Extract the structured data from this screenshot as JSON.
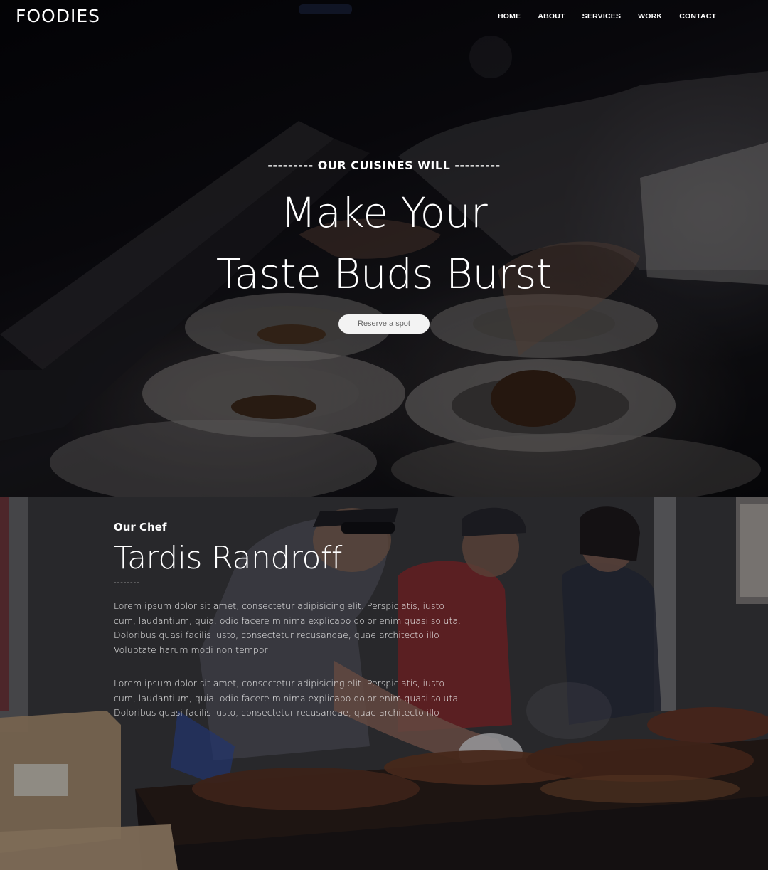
{
  "brand": "FOODIES",
  "nav": {
    "home": "HOME",
    "about": "ABOUT",
    "services": "SERVICES",
    "work": "WORK",
    "contact": "CONTACT"
  },
  "hero": {
    "kicker": "--------- OUR CUISINES WILL ---------",
    "headline_line1": "Make Your",
    "headline_line2": "Taste Buds Burst",
    "cta_label": "Reserve a spot"
  },
  "chef": {
    "eyebrow": "Our Chef",
    "name": "Tardis Randroff",
    "divider": "--------",
    "paragraph1": "Lorem ipsum dolor sit amet, consectetur adipisicing elit. Perspiciatis, iusto cum, laudantium, quia, odio facere minima explicabo dolor enim quasi soluta. Doloribus quasi facilis iusto, consectetur recusandae, quae architecto illo Voluptate harum modi non tempor",
    "paragraph2": "Lorem ipsum dolor sit amet, consectetur adipisicing elit. Perspiciatis, iusto cum, laudantium, quia, odio facere minima explicabo dolor enim quasi soluta. Doloribus quasi facilis iusto, consectetur recusandae, quae architecto illo"
  },
  "colors": {
    "hero_overlay": "#0a0a0e",
    "cta_bg": "#f3f3f3",
    "cta_text": "#666666",
    "text": "#ffffff"
  }
}
